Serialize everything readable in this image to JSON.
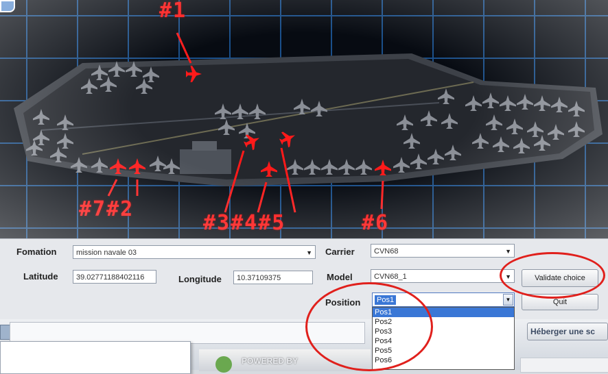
{
  "viewport": {
    "callouts": [
      "#1",
      "#7#2",
      "#3#4#5",
      "#6"
    ]
  },
  "form": {
    "formation": {
      "label": "Fomation",
      "value": "mission navale 03"
    },
    "latitude": {
      "label": "Latitude",
      "value": "39.02771188402116"
    },
    "longitude": {
      "label": "Longitude",
      "value": "10.37109375"
    },
    "carrier": {
      "label": "Carrier",
      "value": "CVN68"
    },
    "model": {
      "label": "Model",
      "value": "CVN68_1"
    },
    "position": {
      "label": "Position",
      "value": "Pos1",
      "options": [
        "Pos1",
        "Pos2",
        "Pos3",
        "Pos4",
        "Pos5",
        "Pos6"
      ]
    },
    "validate_label": "Validate choice",
    "quit_label": "Quit"
  },
  "taskbar": {
    "powered_by": "POWERED BY",
    "host_button": "Héberger une sc"
  },
  "colors": {
    "callout_red": "#ff1616",
    "grid_blue": "#1a4f8a",
    "highlight_ring": "#e0201c",
    "selection_blue": "#3a77d6"
  }
}
